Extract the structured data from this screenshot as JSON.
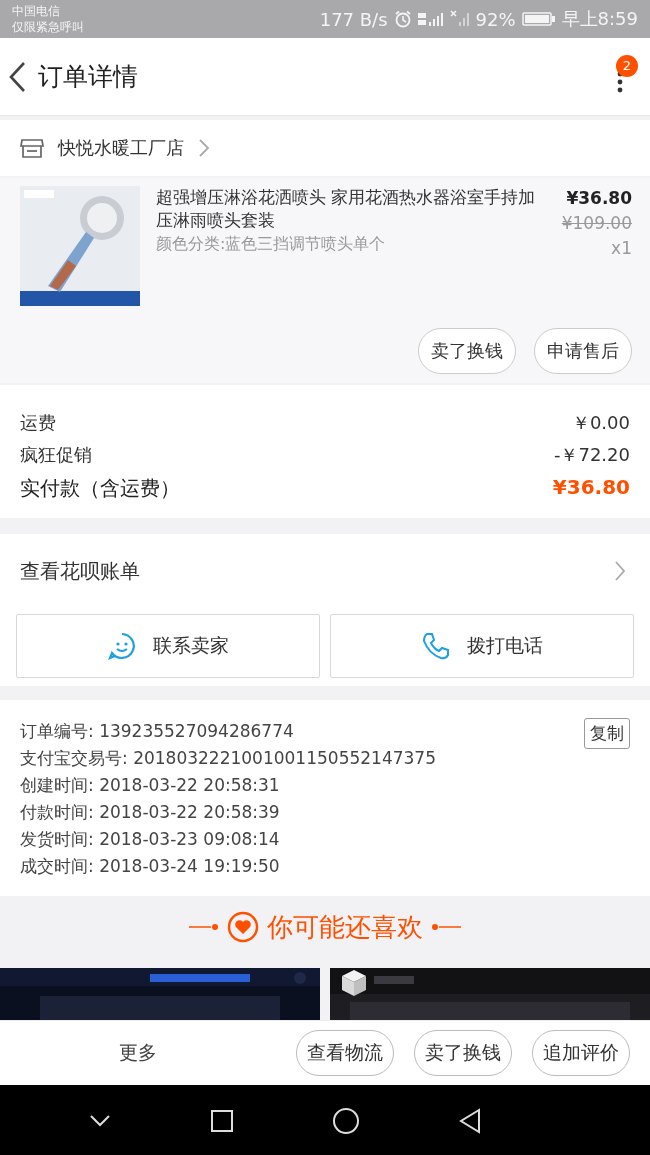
{
  "status_bar": {
    "carrier": "中国电信",
    "carrier_note": "仅限紧急呼叫",
    "speed": "177 B/s",
    "battery": "92%",
    "time": "早上8:59"
  },
  "header": {
    "title": "订单详情",
    "badge": "2"
  },
  "shop": {
    "name": "快悦水暖工厂店"
  },
  "item": {
    "image": {
      "kind": "picture"
    },
    "title": "超强增压淋浴花洒喷头 家用花酒热水器浴室手持加压淋雨喷头套装",
    "variant": "颜色分类:蓝色三挡调节喷头单个",
    "price": "¥36.80",
    "original_price": "¥109.00",
    "quantity": "x1",
    "actions": [
      "卖了换钱",
      "申请售后"
    ]
  },
  "fees": [
    {
      "kind": "normal",
      "label": "运费",
      "value": "￥0.00"
    },
    {
      "kind": "normal",
      "label": "疯狂促销",
      "value": "-￥72.20"
    },
    {
      "kind": "total",
      "label": "实付款（含运费）",
      "value": "¥36.80"
    }
  ],
  "huabei": {
    "label": "查看花呗账单"
  },
  "contact": [
    {
      "kind": "chat",
      "label": "联系卖家"
    },
    {
      "kind": "phone",
      "label": "拨打电话"
    }
  ],
  "order_info": {
    "copy_button": "复制",
    "rows": [
      "订单编号: 139235527094286774",
      "支付宝交易号: 2018032221001001150552147375",
      "创建时间: 2018-03-22 20:58:31",
      "付款时间: 2018-03-22 20:58:39",
      "发货时间: 2018-03-23 09:08:14",
      "成交时间: 2018-03-24 19:19:50"
    ]
  },
  "recommend": {
    "title": "你可能还喜欢",
    "items": [
      {
        "kind": "picture"
      },
      {
        "kind": "picture"
      }
    ]
  },
  "bottom_bar": {
    "more": "更多",
    "buttons": [
      "查看物流",
      "卖了换钱",
      "追加评价"
    ]
  }
}
